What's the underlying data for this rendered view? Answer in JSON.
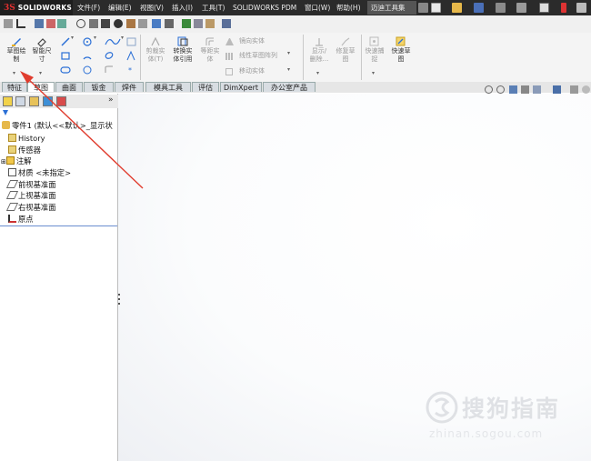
{
  "app": {
    "brand_prefix": "3S",
    "brand_name": "SOLIDWORKS"
  },
  "menu": [
    "文件(F)",
    "编辑(E)",
    "视图(V)",
    "插入(I)",
    "工具(T)",
    "SOLIDWORKS PDM",
    "窗口(W)",
    "帮助(H)",
    "迈迪工具集"
  ],
  "commands": {
    "sketch": "草图绘制",
    "smart_dim_l1": "智能尺",
    "smart_dim_l2": "寸",
    "trim_l1": "剪裁实",
    "trim_l2": "体(T)",
    "convert_l1": "转换实",
    "convert_l2": "体引用",
    "offset_l1": "等距实",
    "offset_l2": "体",
    "mirror": "镜向实体",
    "linear_pattern": "线性草图阵列",
    "move": "移动实体",
    "show_delete_l1": "显示/",
    "show_delete_l2": "删除...",
    "repair_l1": "修复草",
    "repair_l2": "图",
    "quick_snap_l1": "快速捕",
    "quick_snap_l2": "捉",
    "rapid_sketch_l1": "快速草",
    "rapid_sketch_l2": "图"
  },
  "tabs": [
    "特征",
    "草图",
    "曲面",
    "钣金",
    "焊件",
    "模具工具",
    "评估",
    "DimXpert",
    "办公室产品"
  ],
  "active_tab": "草图",
  "tree": {
    "root": "零件1 (默认<<默认>_显示状",
    "items": [
      "History",
      "传感器",
      "注解",
      "材质 <未指定>",
      "前视基准面",
      "上视基准面",
      "右视基准面",
      "原点"
    ]
  },
  "watermark": {
    "text": "搜狗指南",
    "url": "zhinan.sogou.com"
  },
  "colors": {
    "titlebar": "#2b2b2b",
    "arrow": "#e03c2e",
    "accent": "#2a6fd6"
  }
}
